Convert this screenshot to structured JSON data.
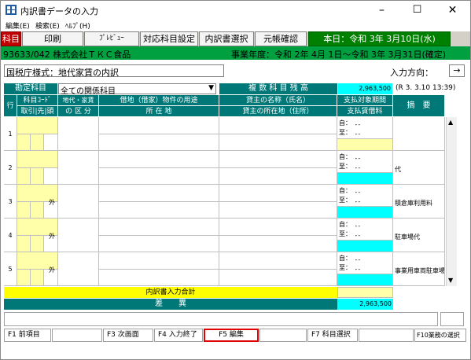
{
  "window": {
    "title": "内訳書データの入力",
    "minimize": "–",
    "maximize": "☐",
    "close": "✕"
  },
  "menu": [
    "編集(E)",
    "検索(E)",
    "ﾍﾙﾌﾟ(H)"
  ],
  "toolbar": {
    "kamoku": "科目",
    "print": "印刷",
    "preview": "ﾌﾟﾚﾋﾞｭｰ",
    "taiou": "対応科目設定",
    "uchiwake_select": "内訳書選択",
    "motocho": "元帳確認",
    "date": "本日：令和 3年 3月10日(水)"
  },
  "info": {
    "company": "93633/042 株式会社ＴＫＣ食品",
    "fiscal": "事業年度：令和 2年 4月 1日～令和 3年 3月31日(確定)"
  },
  "form": {
    "type_label": "国税庁様式：地代家賃の内訳",
    "direction_label": "入力方向：",
    "direction_value": "→"
  },
  "filter": {
    "label": "勘定科目",
    "value": "全ての関係科目",
    "balance_label": "複 数 科 目 残 高",
    "balance_value": "2,963,500",
    "balance_note": "(R 3. 3.10 13:39)"
  },
  "table": {
    "headers": {
      "gyo": "行",
      "kamoku_code": "科目ｺｰﾄﾞ",
      "torihiki": "取引|先|頭",
      "chidai": "地代・家賃",
      "kubun": "の 区 分",
      "youto": "借地（借家）物件の用途",
      "shozai": "所 在 地",
      "kashinushi": "貸主の名称（氏名）",
      "kashinushi_addr": "貸主の所在地（住所）",
      "kikan": "支払対象期間",
      "chinryo": "支払賃借料",
      "tekiyo": "摘　要"
    },
    "rows": [
      {
        "no": "1",
        "kubun": "",
        "from": "自：　．．",
        "to": "至：　．．",
        "tekiyo": ""
      },
      {
        "no": "2",
        "kubun": "",
        "from": "自：　．．",
        "to": "至：　．．",
        "tekiyo": "代"
      },
      {
        "no": "3",
        "kubun": "外",
        "from": "自：　．．",
        "to": "至：　．．",
        "tekiyo": "積倉庫利用料"
      },
      {
        "no": "4",
        "kubun": "外",
        "from": "自：　．．",
        "to": "至：　．．",
        "tekiyo": "駐車場代"
      },
      {
        "no": "5",
        "kubun": "外",
        "from": "自：　．．",
        "to": "至：　．．",
        "tekiyo": "事業用車両駐車場"
      }
    ],
    "total_label": "内訳書入力合計",
    "diff_label": "差　　異",
    "diff_value": "2,963,500"
  },
  "fkeys": {
    "f1": "F1 前項目",
    "f3": "F3 次画面",
    "f4": "F4 入力終了",
    "f5": "F5 編集",
    "f7": "F7 科目選択",
    "f10": "F10業務の選択"
  },
  "colors": {
    "teal": "#007878",
    "cyan": "#00ffff",
    "green": "#00a040",
    "yellow": "#ffff00",
    "red_highlight": "#e00000"
  }
}
